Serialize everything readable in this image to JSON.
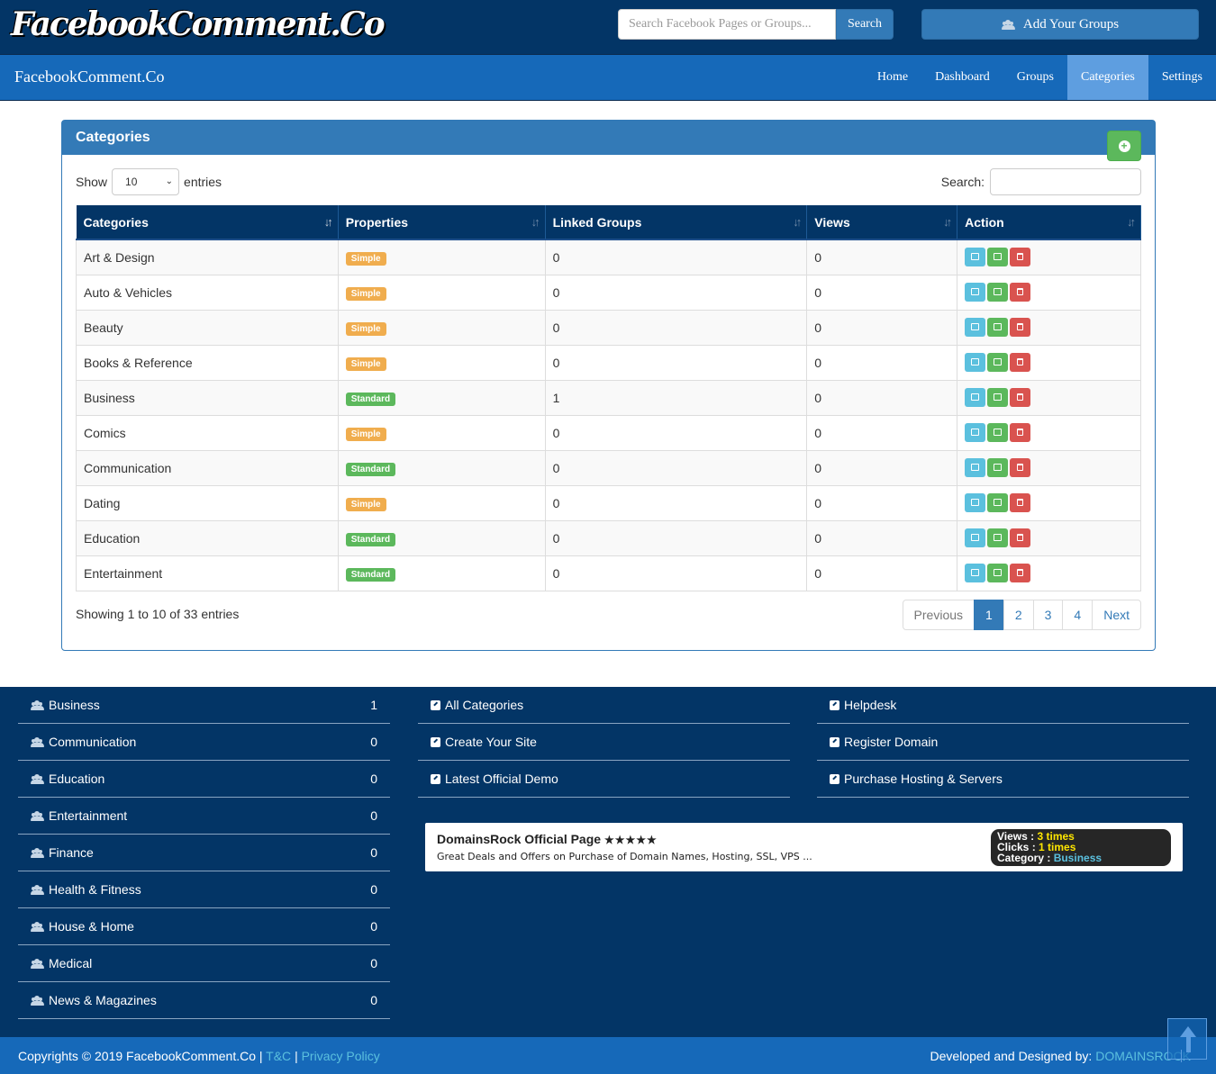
{
  "header": {
    "logo": "FacebookComment.Co",
    "search_placeholder": "Search Facebook Pages or Groups...",
    "search_button": "Search",
    "add_groups": "Add Your Groups"
  },
  "navbar": {
    "brand": "FacebookComment.Co",
    "items": [
      "Home",
      "Dashboard",
      "Groups",
      "Categories",
      "Settings"
    ],
    "active": "Categories"
  },
  "panel": {
    "title": "Categories",
    "show_label": "Show",
    "entries_value": "10",
    "entries_label": "entries",
    "search_label": "Search:",
    "columns": [
      "Categories",
      "Properties",
      "Linked Groups",
      "Views",
      "Action"
    ],
    "rows": [
      {
        "name": "Art & Design",
        "prop": "Simple",
        "linked": "0",
        "views": "0"
      },
      {
        "name": "Auto & Vehicles",
        "prop": "Simple",
        "linked": "0",
        "views": "0"
      },
      {
        "name": "Beauty",
        "prop": "Simple",
        "linked": "0",
        "views": "0"
      },
      {
        "name": "Books & Reference",
        "prop": "Simple",
        "linked": "0",
        "views": "0"
      },
      {
        "name": "Business",
        "prop": "Standard",
        "linked": "1",
        "views": "0"
      },
      {
        "name": "Comics",
        "prop": "Simple",
        "linked": "0",
        "views": "0"
      },
      {
        "name": "Communication",
        "prop": "Standard",
        "linked": "0",
        "views": "0"
      },
      {
        "name": "Dating",
        "prop": "Simple",
        "linked": "0",
        "views": "0"
      },
      {
        "name": "Education",
        "prop": "Standard",
        "linked": "0",
        "views": "0"
      },
      {
        "name": "Entertainment",
        "prop": "Standard",
        "linked": "0",
        "views": "0"
      }
    ],
    "info": "Showing 1 to 10 of 33 entries",
    "pagination": [
      "Previous",
      "1",
      "2",
      "3",
      "4",
      "Next"
    ],
    "current_page": "1"
  },
  "footer": {
    "groups": [
      {
        "name": "Business",
        "count": "1"
      },
      {
        "name": "Communication",
        "count": "0"
      },
      {
        "name": "Education",
        "count": "0"
      },
      {
        "name": "Entertainment",
        "count": "0"
      },
      {
        "name": "Finance",
        "count": "0"
      },
      {
        "name": "Health & Fitness",
        "count": "0"
      },
      {
        "name": "House & Home",
        "count": "0"
      },
      {
        "name": "Medical",
        "count": "0"
      },
      {
        "name": "News & Magazines",
        "count": "0"
      }
    ],
    "links_mid": [
      "All Categories",
      "Create Your Site",
      "Latest Official Demo"
    ],
    "links_right": [
      "Helpdesk",
      "Register Domain",
      "Purchase Hosting & Servers"
    ],
    "card": {
      "title": "DomainsRock Official Page",
      "stars": "★★★★★",
      "desc": "Great Deals and Offers on Purchase of Domain Names, Hosting, SSL, VPS ...",
      "views_label": "Views :",
      "views_value": "3 times",
      "clicks_label": "Clicks :",
      "clicks_value": "1 times",
      "category_label": "Category :",
      "category_value": "Business"
    }
  },
  "bottom": {
    "copyright": "Copyrights © 2019 FacebookComment.Co |",
    "tc": "T&C",
    "sep": "|",
    "privacy": "Privacy Policy",
    "dev_label": "Developed and Designed by:",
    "dev_link": "DOMAINSROCK"
  },
  "colors": {
    "primary": "#337ab7",
    "dark": "#033566",
    "nav": "#1669b9",
    "simple": "#f0ad4e",
    "standard": "#5cb85c",
    "danger": "#d9534f",
    "info": "#5bc0de"
  }
}
